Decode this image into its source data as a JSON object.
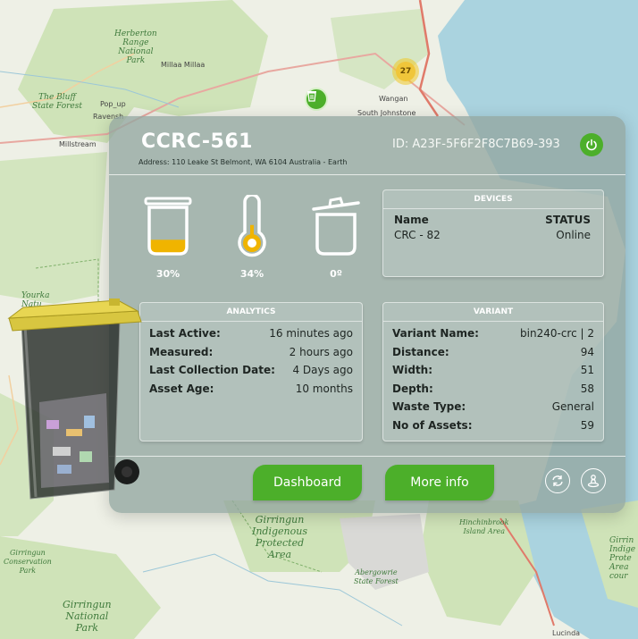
{
  "map": {
    "cluster_count": "27",
    "labels": {
      "herberton": "Herberton\nRange\nNational\nPark",
      "millaa": "Millaa Millaa",
      "bluff": "The Bluff\nState Forest",
      "popup": "Pop_up",
      "ravensh": "Ravensh",
      "millstream": "Millstream",
      "wangan": "Wangan",
      "southjohn": "South Johnstone",
      "yourka": "Yourka\nNatu",
      "girringun_np": "Girringun\nNational\nPark",
      "girringun_cons": "Girringun\nConservation\nPark",
      "girringun_ipa": "Girringun\nIndigenous\nProtected\nArea",
      "abergowrie": "Abergowrie\nState Forest",
      "hinchinbrook": "Hinchinbrook\nIsland Area",
      "girringun_right": "Girrin\nIndige\nProte\nArea\ncour",
      "lucinda": "Lucinda"
    }
  },
  "panel": {
    "title": "CCRC-561",
    "address": "Address: 110 Leake St Belmont, WA 6104 Australia - Earth",
    "device_id": "ID: A23F-5F6F2F8C7B69-393",
    "gauges": [
      {
        "name": "fill-level",
        "label": "30%",
        "fill_level": 0.3
      },
      {
        "name": "temperature",
        "label": "34%",
        "level": 0.34
      },
      {
        "name": "tilt",
        "label": "0º"
      }
    ],
    "devices": {
      "header": "DEVICES",
      "col_name": "Name",
      "col_status": "STATUS",
      "rows": [
        {
          "name": "CRC - 82",
          "status": "Online"
        }
      ]
    },
    "analytics": {
      "header": "ANALYTICS",
      "rows": [
        {
          "key": "Last Active:",
          "value": "16 minutes ago"
        },
        {
          "key": "Measured:",
          "value": "2 hours ago"
        },
        {
          "key": "Last Collection Date:",
          "value": "4 Days ago"
        },
        {
          "key": "Asset Age:",
          "value": "10 months"
        }
      ]
    },
    "variant": {
      "header": "VARIANT",
      "rows": [
        {
          "key": "Variant Name:",
          "value": "bin240-crc | 2"
        },
        {
          "key": "Distance:",
          "value": "94"
        },
        {
          "key": "Width:",
          "value": "51"
        },
        {
          "key": "Depth:",
          "value": "58"
        },
        {
          "key": "Waste Type:",
          "value": "General"
        },
        {
          "key": "No of Assets:",
          "value": "59"
        }
      ]
    },
    "buttons": {
      "dashboard": "Dashboard",
      "more_info": "More info"
    },
    "icons": {
      "power": "power-icon",
      "refresh": "refresh-icon",
      "locate": "person-pin-icon"
    },
    "colors": {
      "accent": "#4caf2a",
      "fill": "#f0b400"
    }
  }
}
